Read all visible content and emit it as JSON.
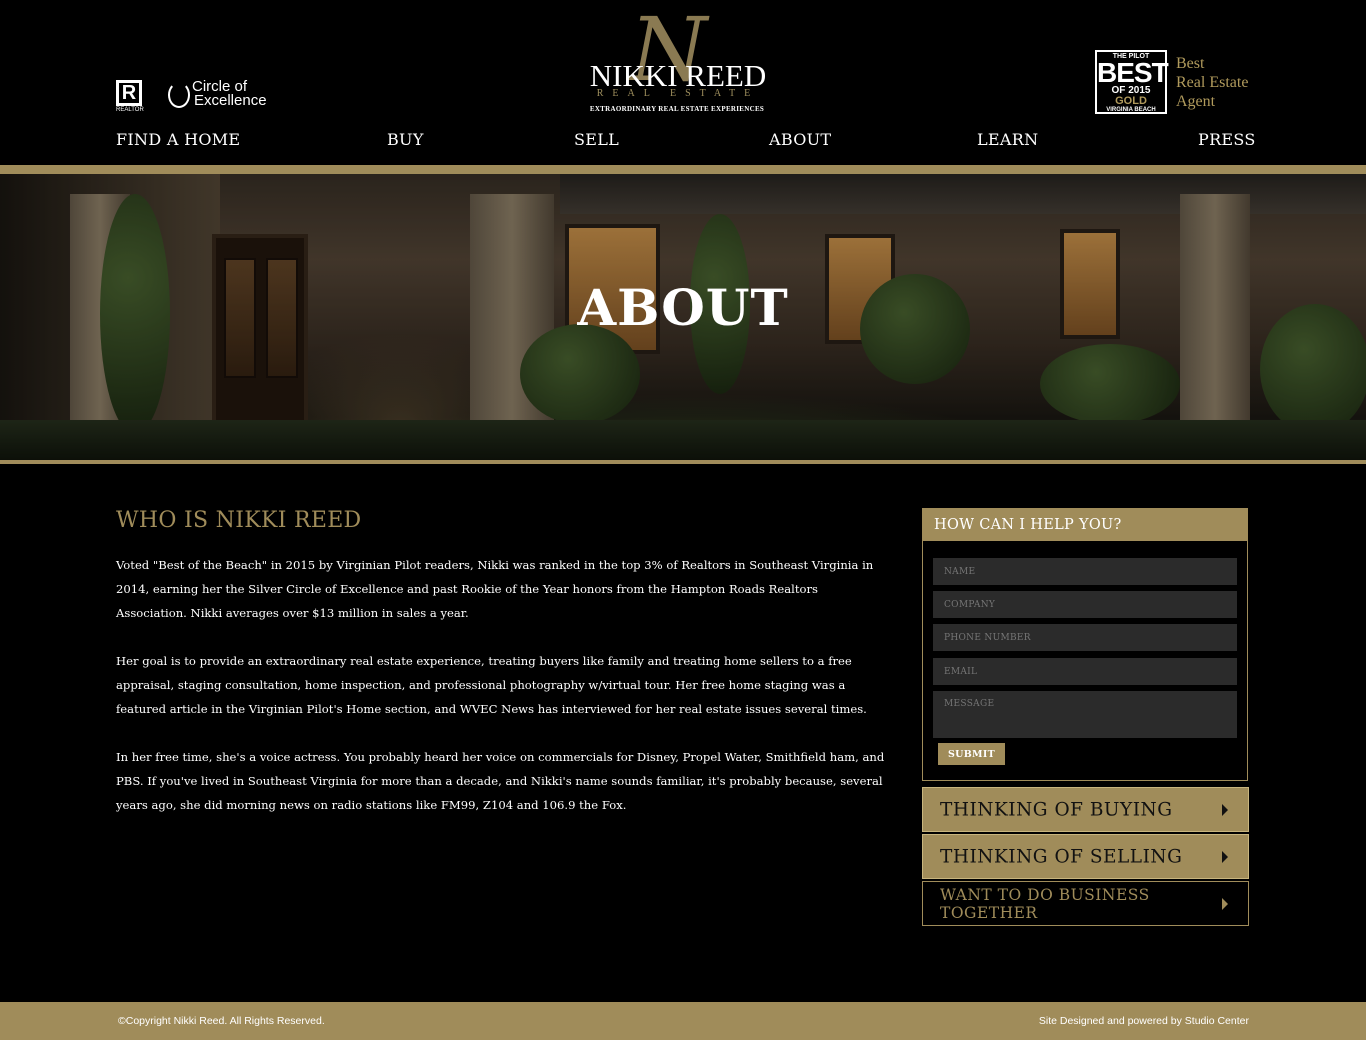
{
  "header": {
    "realtor_badge_letter": "R",
    "realtor_badge_word": "REALTOR",
    "coe_line1": "Circle of",
    "coe_line2": "Excellence",
    "logo": {
      "monogram": "N",
      "name": "NIKKI REED",
      "sub": "REAL ESTATE",
      "tagline": "EXTRAORDINARY REAL ESTATE EXPERIENCES"
    },
    "award": {
      "line1": "THE PILOT",
      "line2": "BEST",
      "line3": "OF 2015",
      "line4": "GOLD",
      "line5": "VIRGINIA BEACH",
      "text1": "Best",
      "text2": "Real Estate",
      "text3": "Agent"
    }
  },
  "nav": {
    "items": [
      {
        "label": "FIND A HOME"
      },
      {
        "label": "BUY"
      },
      {
        "label": "SELL"
      },
      {
        "label": "ABOUT"
      },
      {
        "label": "LEARN"
      },
      {
        "label": "PRESS"
      }
    ]
  },
  "hero": {
    "title": "ABOUT"
  },
  "main": {
    "heading": "WHO IS NIKKI REED",
    "paragraphs": [
      "Voted \"Best of the Beach\" in 2015 by Virginian Pilot readers, Nikki was ranked in the top 3% of Realtors in Southeast Virginia in 2014, earning her the Silver Circle of Excellence and past Rookie of the Year honors from the Hampton Roads Realtors Association. Nikki averages over $13 million in sales a year.",
      "Her goal is to provide an extraordinary real estate experience, treating buyers like family and treating home sellers to a free appraisal, staging consultation, home inspection, and professional photography w/virtual tour. Her free home staging was a featured article in the Virginian Pilot's Home section, and WVEC News has interviewed for her real estate issues several times.",
      "In her free time, she's a voice actress. You probably heard her voice on commercials for Disney, Propel Water, Smithfield ham, and PBS. If you've lived in Southeast Virginia for more than a decade, and Nikki's name sounds familiar, it's probably because, several years ago, she did morning news on radio stations like FM99, Z104 and 106.9 the Fox."
    ]
  },
  "contact_form": {
    "title": "HOW CAN I HELP YOU?",
    "name_placeholder": "NAME",
    "company_placeholder": "COMPANY",
    "phone_placeholder": "PHONE NUMBER",
    "email_placeholder": "EMAIL",
    "message_placeholder": "MESSAGE",
    "submit_label": "SUBMIT"
  },
  "ctas": {
    "buying": "THINKING OF BUYING",
    "selling": "THINKING OF SELLING",
    "business": "WANT TO DO BUSINESS TOGETHER"
  },
  "footer": {
    "copyright": "©Copyright Nikki Reed. All Rights Reserved.",
    "credit": "Site Designed and powered by Studio Center"
  },
  "colors": {
    "accent_gold": "#a08c5a",
    "background": "#000000",
    "field_bg": "#2b2b2b"
  }
}
